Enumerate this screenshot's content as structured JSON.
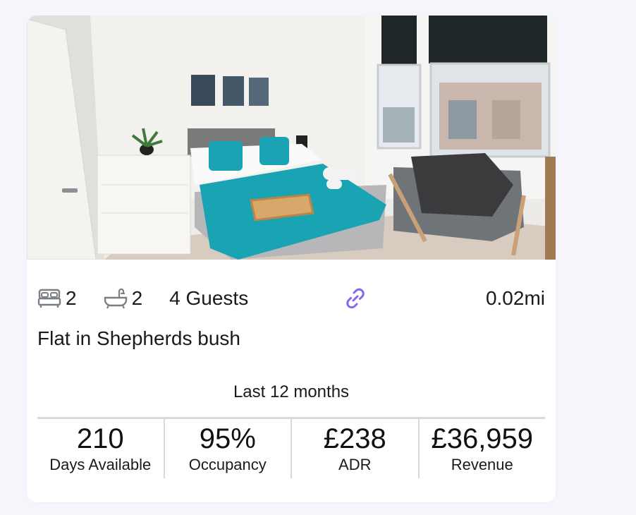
{
  "listing": {
    "bedrooms": "2",
    "bathrooms": "2",
    "guests": "4 Guests",
    "distance": "0.02mi",
    "title": "Flat in Shepherds bush"
  },
  "performance": {
    "period": "Last 12 months",
    "metrics": [
      {
        "value": "210",
        "label": "Days Available"
      },
      {
        "value": "95%",
        "label": "Occupancy"
      },
      {
        "value": "£238",
        "label": "ADR"
      },
      {
        "value": "£36,959",
        "label": "Revenue"
      }
    ]
  },
  "colors": {
    "accent": "#8a63f7",
    "bed_teal": "#1aa3b3",
    "divider": "#d9d9dd",
    "text": "#1a1a1a"
  },
  "icons": {
    "bed": "bed-icon",
    "bath": "bathtub-icon",
    "link": "link-icon"
  }
}
